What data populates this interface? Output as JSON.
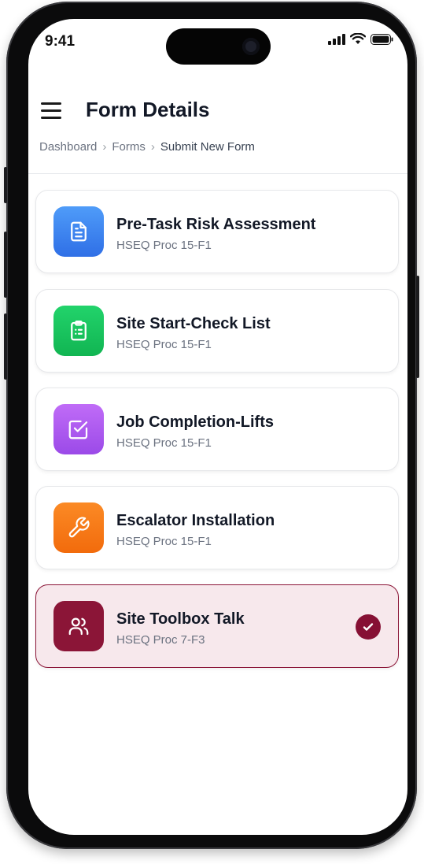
{
  "status": {
    "time": "9:41"
  },
  "header": {
    "title": "Form Details"
  },
  "breadcrumb": {
    "items": [
      "Dashboard",
      "Forms",
      "Submit New Form"
    ],
    "separator": "›"
  },
  "forms": [
    {
      "title": "Pre-Task Risk Assessment",
      "code": "HSEQ Proc 15-F1",
      "icon": "document-icon",
      "color": "#3b82f6",
      "selected": false
    },
    {
      "title": "Site Start-Check List",
      "code": "HSEQ Proc 15-F1",
      "icon": "clipboard-icon",
      "color": "#16c45a",
      "selected": false
    },
    {
      "title": "Job Completion-Lifts",
      "code": "HSEQ Proc 15-F1",
      "icon": "checkbox-icon",
      "color": "#a855f7",
      "selected": false
    },
    {
      "title": "Escalator Installation",
      "code": "HSEQ Proc 15-F1",
      "icon": "wrench-icon",
      "color": "#f97316",
      "selected": false
    },
    {
      "title": "Site Toolbox Talk",
      "code": "HSEQ Proc 7-F3",
      "icon": "users-icon",
      "color": "#8b1537",
      "selected": true
    }
  ],
  "theme": {
    "accent": "#861034"
  }
}
